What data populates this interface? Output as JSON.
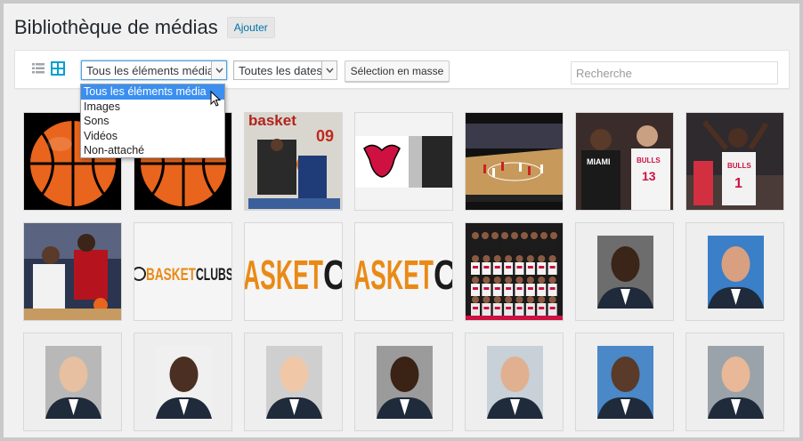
{
  "header": {
    "title": "Bibliothèque de médias",
    "add_label": "Ajouter"
  },
  "toolbar": {
    "view_list_icon": "list-view-icon",
    "view_grid_icon": "grid-view-icon",
    "type_filter": {
      "selected": "Tous les éléments média"
    },
    "date_filter": {
      "selected": "Toutes les dates"
    },
    "bulk_select_label": "Sélection en masse",
    "search_placeholder": "Recherche"
  },
  "type_dropdown": {
    "options": [
      "Tous les éléments média",
      "Images",
      "Sons",
      "Vidéos",
      "Non-attaché"
    ],
    "highlighted_index": 0
  },
  "media": {
    "tiles": [
      {
        "kind": "basketball-ball"
      },
      {
        "kind": "basketball-ball"
      },
      {
        "kind": "magazine-cover",
        "text": "basket",
        "number": "09"
      },
      {
        "kind": "bulls-logo"
      },
      {
        "kind": "arena-game"
      },
      {
        "kind": "players-miami-bulls",
        "jersey_left": "MIAMI",
        "jersey_right": "BULLS",
        "num_right": "13"
      },
      {
        "kind": "players-bulls",
        "jersey": "BULLS",
        "num": "1"
      },
      {
        "kind": "player-dribble"
      },
      {
        "kind": "basketclubs-logo",
        "text_a": "BASKET",
        "text_b": "CLUBS"
      },
      {
        "kind": "basket-crop",
        "text_a": "ASKET",
        "text_b": "C"
      },
      {
        "kind": "basket-crop",
        "text_a": "ASKET",
        "text_b": "C"
      },
      {
        "kind": "team-photo"
      },
      {
        "kind": "portrait"
      },
      {
        "kind": "portrait"
      },
      {
        "kind": "portrait"
      },
      {
        "kind": "portrait"
      },
      {
        "kind": "portrait"
      },
      {
        "kind": "portrait"
      },
      {
        "kind": "portrait"
      },
      {
        "kind": "portrait"
      },
      {
        "kind": "portrait"
      }
    ]
  },
  "colors": {
    "accent": "#0073aa",
    "selection_blue": "#3b8ff0",
    "grid_icon_blue": "#00a0d2",
    "ball_orange": "#e9641c",
    "basket_orange": "#e98a16",
    "bulls_red": "#ce1141"
  }
}
